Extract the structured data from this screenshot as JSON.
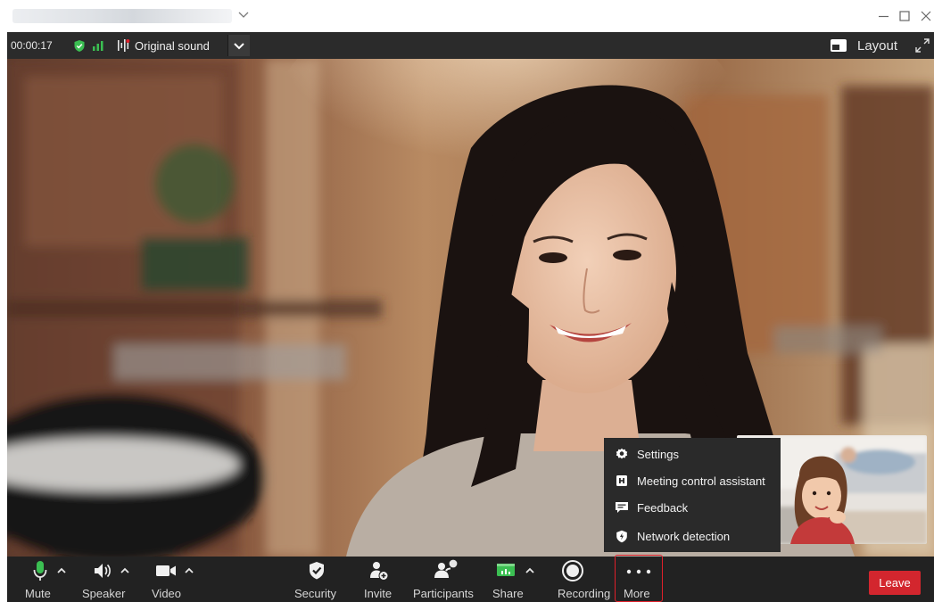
{
  "titlebar": {
    "icons": [
      "dropdown-chevron-icon",
      "minimize-icon",
      "maximize-icon",
      "close-icon"
    ]
  },
  "statusbar": {
    "timer": "00:00:17",
    "original_sound_label": "Original sound",
    "layout_label": "Layout",
    "icons": [
      "security-shield-icon",
      "signal-strength-icon",
      "original-sound-icon",
      "chevron-down-icon",
      "layout-icon",
      "expand-icon"
    ]
  },
  "more_menu": {
    "items": [
      {
        "label": "Settings",
        "icon": "gear-icon"
      },
      {
        "label": "Meeting control assistant",
        "icon": "assistant-icon"
      },
      {
        "label": "Feedback",
        "icon": "feedback-icon"
      },
      {
        "label": "Network detection",
        "icon": "network-shield-icon"
      }
    ]
  },
  "toolbar": {
    "mute": "Mute",
    "speaker": "Speaker",
    "video": "Video",
    "security": "Security",
    "invite": "Invite",
    "participants": "Participants",
    "share": "Share",
    "recording": "Recording",
    "more": "More",
    "leave": "Leave"
  },
  "colors": {
    "accent_green": "#3bbf52",
    "leave_red": "#d3262e",
    "highlight_red": "#e0202a",
    "toolbar_bg": "#222222",
    "menu_bg": "#2a2a2a"
  }
}
